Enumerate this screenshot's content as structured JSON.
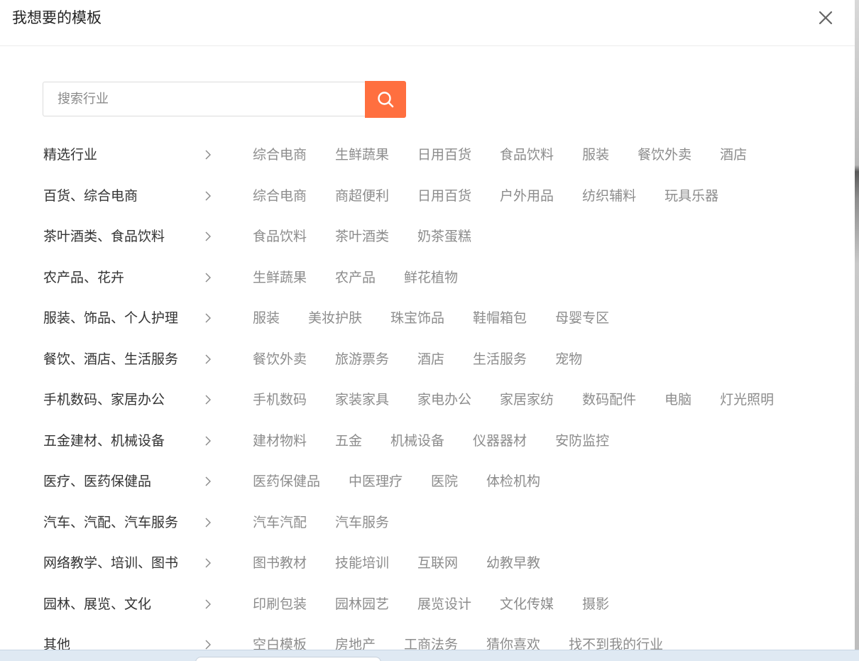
{
  "dialog": {
    "title": "我想要的模板",
    "close_icon": "close-icon"
  },
  "search": {
    "placeholder": "搜索行业",
    "value": "",
    "button_icon": "search-icon",
    "button_color": "#ff6f3f"
  },
  "categories": [
    {
      "name": "精选行业",
      "tags": [
        "综合电商",
        "生鲜蔬果",
        "日用百货",
        "食品饮料",
        "服装",
        "餐饮外卖",
        "酒店"
      ]
    },
    {
      "name": "百货、综合电商",
      "tags": [
        "综合电商",
        "商超便利",
        "日用百货",
        "户外用品",
        "纺织辅料",
        "玩具乐器"
      ]
    },
    {
      "name": "茶叶酒类、食品饮料",
      "tags": [
        "食品饮料",
        "茶叶酒类",
        "奶茶蛋糕"
      ]
    },
    {
      "name": "农产品、花卉",
      "tags": [
        "生鲜蔬果",
        "农产品",
        "鲜花植物"
      ]
    },
    {
      "name": "服装、饰品、个人护理",
      "tags": [
        "服装",
        "美妆护肤",
        "珠宝饰品",
        "鞋帽箱包",
        "母婴专区"
      ]
    },
    {
      "name": "餐饮、酒店、生活服务",
      "tags": [
        "餐饮外卖",
        "旅游票务",
        "酒店",
        "生活服务",
        "宠物"
      ]
    },
    {
      "name": "手机数码、家居办公",
      "tags": [
        "手机数码",
        "家装家具",
        "家电办公",
        "家居家纺",
        "数码配件",
        "电脑",
        "灯光照明"
      ]
    },
    {
      "name": "五金建材、机械设备",
      "tags": [
        "建材物料",
        "五金",
        "机械设备",
        "仪器器材",
        "安防监控"
      ]
    },
    {
      "name": "医疗、医药保健品",
      "tags": [
        "医药保健品",
        "中医理疗",
        "医院",
        "体检机构"
      ]
    },
    {
      "name": "汽车、汽配、汽车服务",
      "tags": [
        "汽车汽配",
        "汽车服务"
      ]
    },
    {
      "name": "网络教学、培训、图书",
      "tags": [
        "图书教材",
        "技能培训",
        "互联网",
        "幼教早教"
      ]
    },
    {
      "name": "园林、展览、文化",
      "tags": [
        "印刷包装",
        "园林园艺",
        "展览设计",
        "文化传媒",
        "摄影"
      ]
    },
    {
      "name": "其他",
      "tags": [
        "空白模板",
        "房地产",
        "工商法务",
        "猜你喜欢",
        "找不到我的行业"
      ]
    }
  ]
}
